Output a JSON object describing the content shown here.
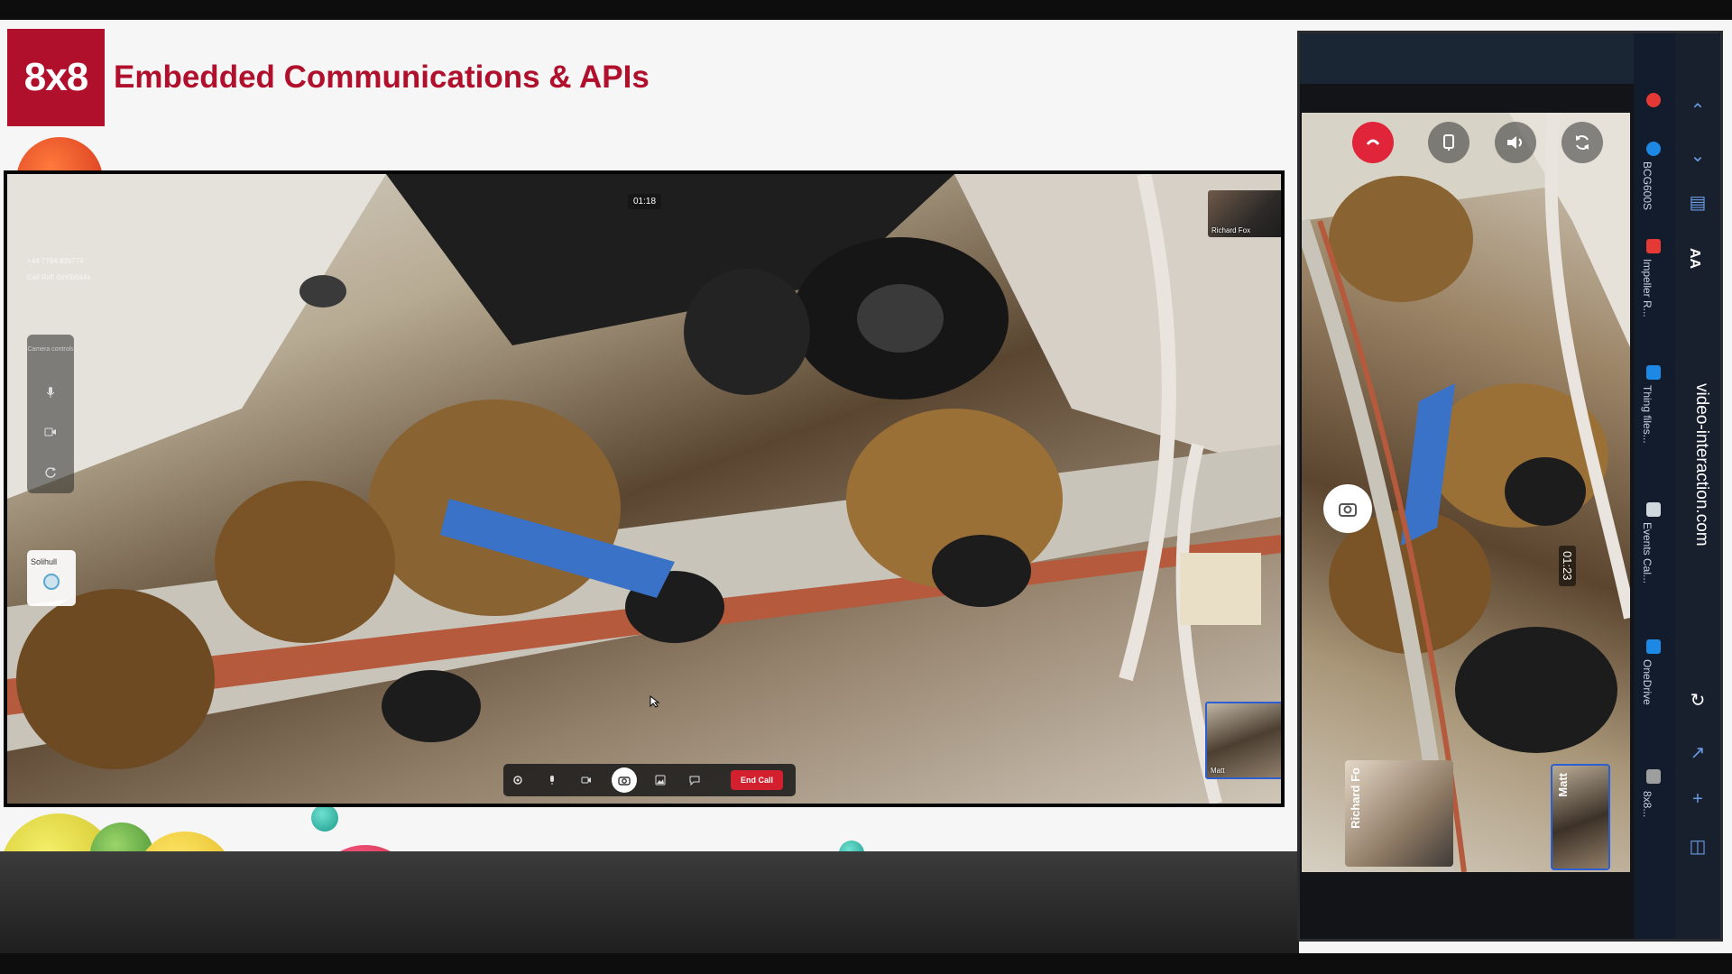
{
  "slide": {
    "logo_text": "8x8",
    "title": "Embedded Communications & APIs"
  },
  "main_call": {
    "timer": "01:18",
    "caller_number": "+44 7764 836774",
    "call_ref": "Call Ref: 0m0b9a4a",
    "toolbar_caption": "Camera controls",
    "location_label": "Solihull",
    "remote_pip_name": "Richard Fox",
    "local_pip_name": "Matt",
    "end_call_label": "End Call",
    "controls": [
      "settings-icon",
      "microphone-icon",
      "camera-icon",
      "snapshot-icon",
      "gallery-icon",
      "chat-icon"
    ]
  },
  "phone": {
    "timer": "01:23",
    "thumb_left_name": "Richard Fo",
    "thumb_right_name": "Matt",
    "url": "video-interaction.com",
    "text_size_label": "AA",
    "tabs": [
      {
        "label": "BCG600S",
        "color": "#1e88e5"
      },
      {
        "label": "Impeller R...",
        "color": "#e53935"
      },
      {
        "label": "Thing files...",
        "color": "#1e88e5"
      },
      {
        "label": "Events Cal...",
        "color": "#cfd8dc"
      },
      {
        "label": "OneDrive",
        "color": "#1e88e5"
      },
      {
        "label": "8x8...",
        "color": "#9e9e9e"
      }
    ]
  },
  "colors": {
    "brand_red": "#b0102c",
    "end_call_red": "#d2202f",
    "highlight_blue": "#2d5fd1"
  }
}
